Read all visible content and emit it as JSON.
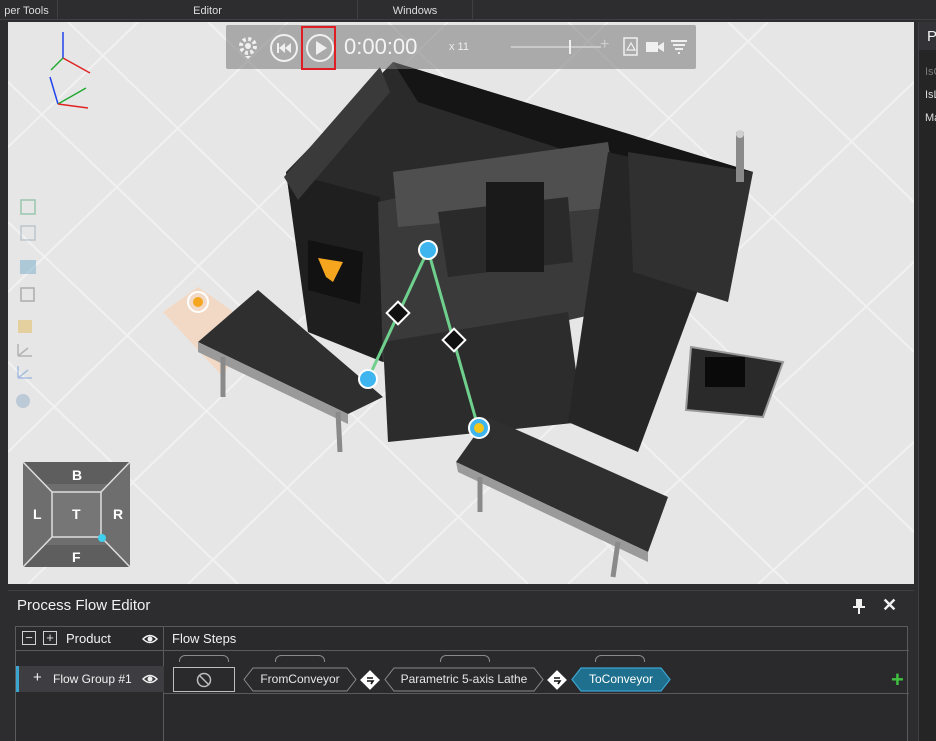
{
  "tabs": {
    "developer_tools": "per Tools",
    "editor": "Editor",
    "windows": "Windows"
  },
  "playback": {
    "time": "0:00:00",
    "speed": "x 11"
  },
  "icons": {
    "gear": "gear-icon",
    "rewind": "rewind-icon",
    "play": "play-icon",
    "pdf": "pdf-icon",
    "camera": "video-camera-icon",
    "settings": "trace-icon"
  },
  "nav_cube": {
    "back": "B",
    "left": "L",
    "top": "T",
    "right": "R",
    "front": "F"
  },
  "right_panel": {
    "title": "P",
    "lines": [
      "IsO",
      "IsL",
      "Ma"
    ]
  },
  "process_flow_editor": {
    "title": "Process Flow Editor",
    "product_header": "Product",
    "flow_steps_header": "Flow Steps",
    "flow_group": "Flow Group #1",
    "steps": [
      "FromConveyor",
      "Parametric 5-axis Lathe",
      "ToConveyor"
    ]
  },
  "colors": {
    "accent": "#3ba5d0",
    "play_highlight": "#e01c24",
    "add": "#3fc13f",
    "active_step": "#1f6f8f"
  }
}
